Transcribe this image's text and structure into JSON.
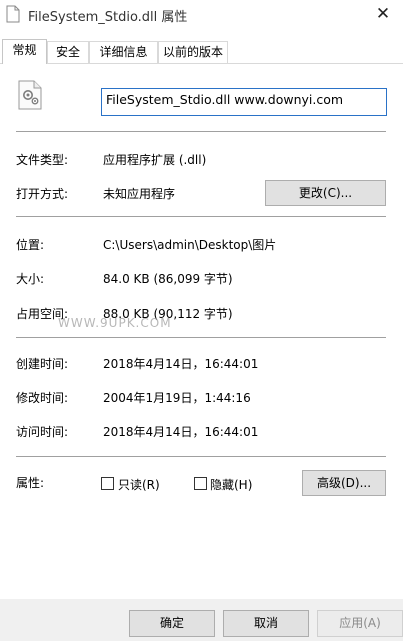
{
  "window": {
    "title": "FileSystem_Stdio.dll 属性",
    "close_glyph": "✕"
  },
  "tabs": [
    {
      "label": "常规",
      "active": true
    },
    {
      "label": "安全",
      "active": false
    },
    {
      "label": "详细信息",
      "active": false
    },
    {
      "label": "以前的版本",
      "active": false
    }
  ],
  "general": {
    "file_name": "FileSystem_Stdio.dll www.downyi.com",
    "file_type_label": "文件类型:",
    "file_type_value": "应用程序扩展 (.dll)",
    "opens_with_label": "打开方式:",
    "opens_with_value": "未知应用程序",
    "change_button": "更改(C)...",
    "location_label": "位置:",
    "location_value": "C:\\Users\\admin\\Desktop\\图片",
    "size_label": "大小:",
    "size_value": "84.0 KB (86,099 字节)",
    "size_on_disk_label": "占用空间:",
    "size_on_disk_value": "88.0 KB (90,112 字节)",
    "created_label": "创建时间:",
    "created_value": "2018年4月14日，16:44:01",
    "modified_label": "修改时间:",
    "modified_value": "2004年1月19日，1:44:16",
    "accessed_label": "访问时间:",
    "accessed_value": "2018年4月14日，16:44:01",
    "attributes_label": "属性:",
    "readonly_label": "只读(R)",
    "hidden_label": "隐藏(H)",
    "advanced_button": "高级(D)..."
  },
  "watermark": "WWW.9UPK.COM",
  "footer": {
    "ok": "确定",
    "cancel": "取消",
    "apply": "应用(A)"
  },
  "colors": {
    "focus_border": "#2a72c7",
    "separator": "#a0a0a0",
    "footer_bg": "#f0f0f0"
  }
}
